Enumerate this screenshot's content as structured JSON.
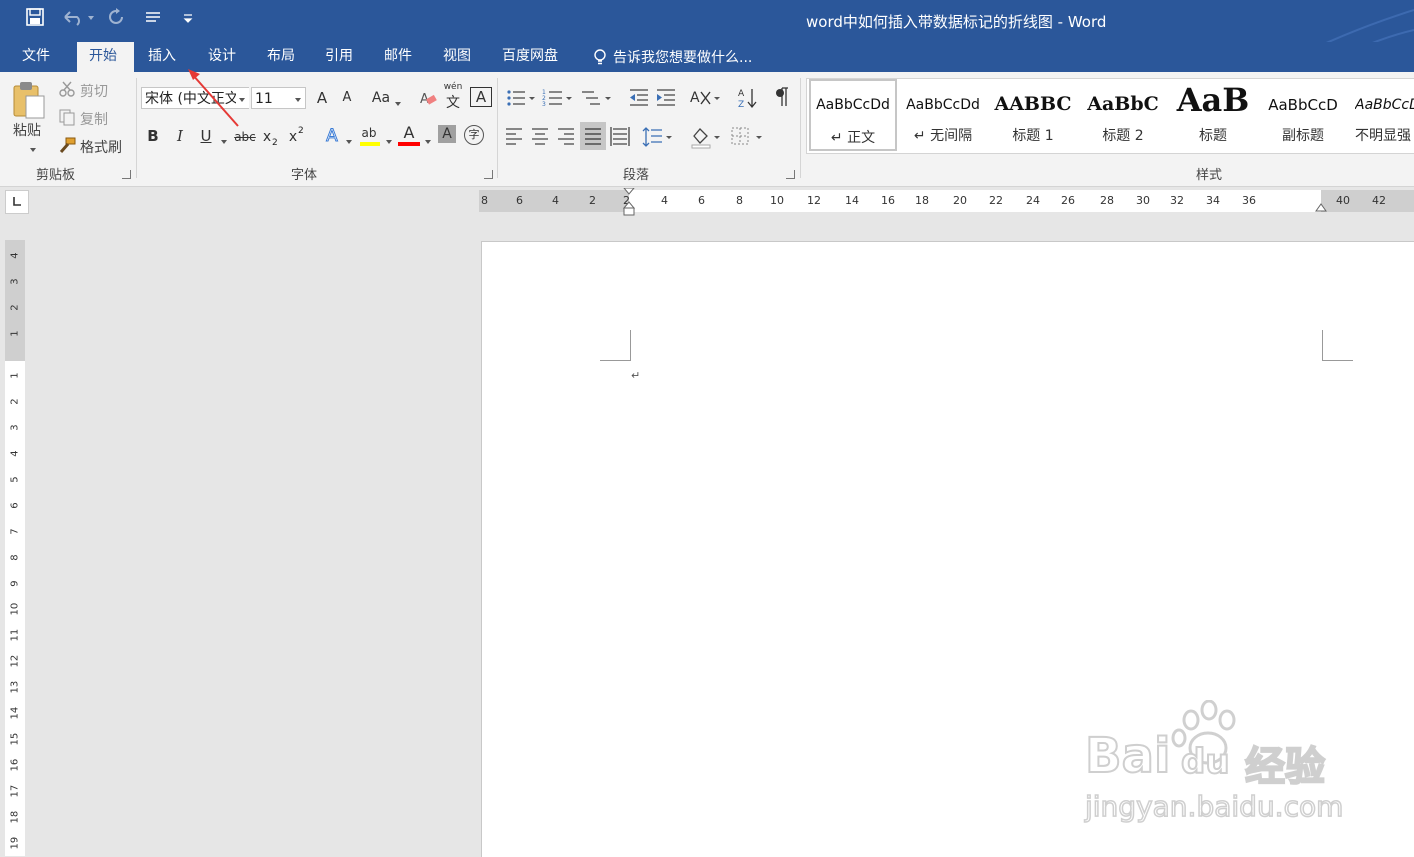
{
  "window": {
    "title": "word中如何插入带数据标记的折线图 - Word"
  },
  "quick_access": {
    "save_icon": "save-icon",
    "undo_icon": "undo-icon",
    "redo_icon": "redo-icon",
    "touch_icon": "touch-mode-icon",
    "customize_icon": "customize-qat-icon"
  },
  "tabs": [
    {
      "label": "文件"
    },
    {
      "label": "开始"
    },
    {
      "label": "插入"
    },
    {
      "label": "设计"
    },
    {
      "label": "布局"
    },
    {
      "label": "引用"
    },
    {
      "label": "邮件"
    },
    {
      "label": "视图"
    },
    {
      "label": "百度网盘"
    }
  ],
  "tell_me": {
    "placeholder": "告诉我您想要做什么..."
  },
  "clipboard": {
    "paste": "粘贴",
    "cut": "剪切",
    "copy": "复制",
    "format_painter": "格式刷",
    "group_label": "剪贴板"
  },
  "font": {
    "font_name": "宋体 (中文正文",
    "font_size": "11",
    "group_label": "字体",
    "grow": "A",
    "shrink": "A",
    "change_case": "Aa",
    "pinyin": "wén",
    "pinyin_char": "文",
    "border_char": "A",
    "bold": "B",
    "italic": "I",
    "underline": "U",
    "strike": "abc",
    "subscript": "x",
    "subscript_mark": "2",
    "superscript": "x",
    "superscript_mark": "2",
    "effects": "A",
    "highlight": "ab",
    "font_color": "A",
    "shading": "A",
    "enclose": "字"
  },
  "paragraph": {
    "group_label": "段落"
  },
  "styles": {
    "group_label": "样式",
    "items": [
      {
        "sample": "AaBbCcDd",
        "name": "↵ 正文"
      },
      {
        "sample": "AaBbCcDd",
        "name": "↵ 无间隔"
      },
      {
        "sample": "AABBC",
        "name": "标题 1"
      },
      {
        "sample": "AaBbC",
        "name": "标题 2"
      },
      {
        "sample": "AaB",
        "name": "标题"
      },
      {
        "sample": "AaBbCcD",
        "name": "副标题"
      },
      {
        "sample": "AaBbCcD",
        "name": "不明显强"
      }
    ]
  },
  "ruler": {
    "h_labels": [
      "8",
      "6",
      "4",
      "2",
      "2",
      "4",
      "6",
      "8",
      "10",
      "12",
      "14",
      "16",
      "18",
      "20",
      "22",
      "24",
      "26",
      "28",
      "30",
      "32",
      "34",
      "36",
      "40",
      "42"
    ],
    "v_labels": [
      "4",
      "3",
      "2",
      "1",
      "1",
      "2",
      "3",
      "4",
      "5",
      "6",
      "7",
      "8",
      "9",
      "10",
      "11",
      "12",
      "13",
      "14",
      "15",
      "16",
      "17",
      "18",
      "19"
    ]
  },
  "document": {
    "paragraph_mark": "↵"
  },
  "watermark": {
    "brand": "Bai",
    "brand2": "du",
    "cn": "经验",
    "url": "jingyan.baidu.com"
  },
  "colors": {
    "title_bar": "#2b579a",
    "highlight_yellow": "#ffff00",
    "font_red": "#ff0000",
    "annotation_arrow": "#e53935"
  }
}
